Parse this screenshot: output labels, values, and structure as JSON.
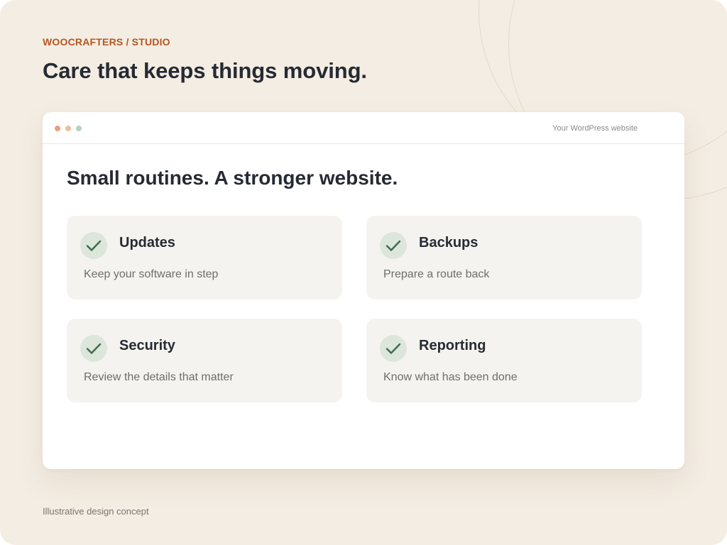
{
  "header": {
    "eyebrow": "WOOCRAFTERS / STUDIO",
    "headline": "Care that keeps things moving."
  },
  "window": {
    "title": "Your WordPress website",
    "dot_colors": [
      "#e8a07f",
      "#ebc19b",
      "#b6d2c0"
    ],
    "content_title": "Small routines. A stronger website.",
    "cards": [
      {
        "icon": "check-icon",
        "title": "Updates",
        "description": "Keep your software in step"
      },
      {
        "icon": "check-icon",
        "title": "Backups",
        "description": "Prepare a route back"
      },
      {
        "icon": "check-icon",
        "title": "Security",
        "description": "Review the details that matter"
      },
      {
        "icon": "check-icon",
        "title": "Reporting",
        "description": "Know what has been done"
      }
    ]
  },
  "footer": {
    "note": "Illustrative design concept"
  },
  "colors": {
    "background": "#f4ede3",
    "accent": "#b5561d",
    "heading": "#262a33",
    "card_background": "#f5f3ef",
    "check_background": "#dce6db",
    "check_mark": "#3f6b4f"
  }
}
